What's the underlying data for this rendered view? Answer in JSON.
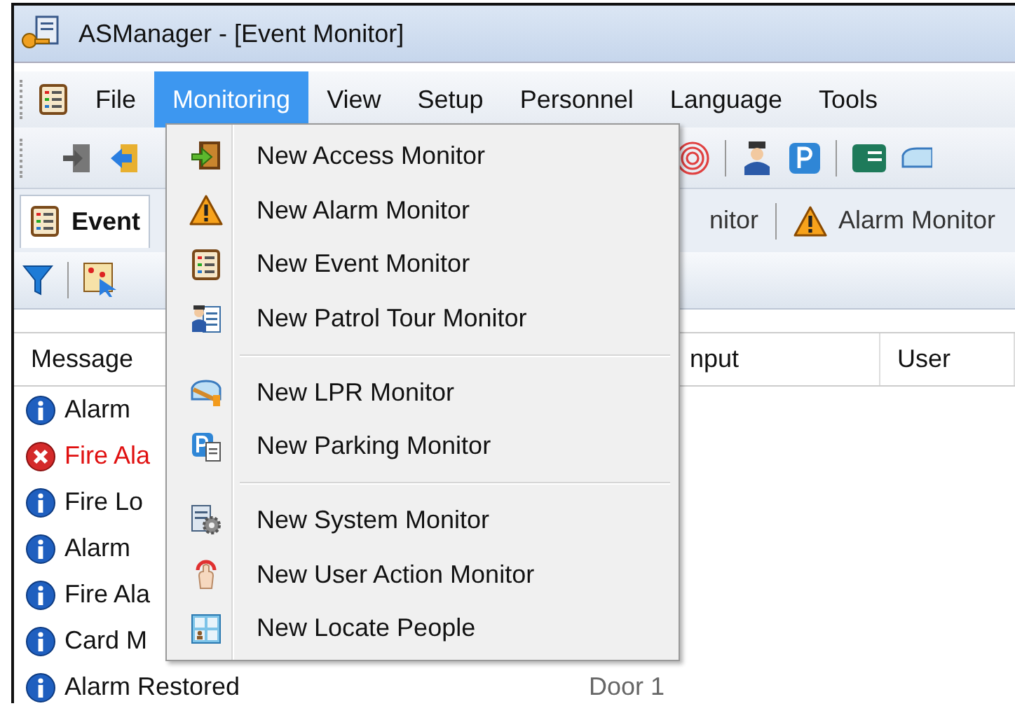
{
  "window": {
    "title": "ASManager - [Event Monitor]"
  },
  "menu_bar": [
    {
      "label": "File",
      "selected": false
    },
    {
      "label": "Monitoring",
      "selected": true
    },
    {
      "label": "View",
      "selected": false
    },
    {
      "label": "Setup",
      "selected": false
    },
    {
      "label": "Personnel",
      "selected": false
    },
    {
      "label": "Language",
      "selected": false
    },
    {
      "label": "Tools",
      "selected": false
    }
  ],
  "dropdown": {
    "groups": [
      [
        {
          "label": "New Access Monitor",
          "kind": "access"
        },
        {
          "label": "New Alarm Monitor",
          "kind": "alarm"
        },
        {
          "label": "New Event Monitor",
          "kind": "event"
        },
        {
          "label": "New Patrol Tour Monitor",
          "kind": "patrol"
        }
      ],
      [
        {
          "label": "New LPR Monitor",
          "kind": "lpr"
        },
        {
          "label": "New Parking Monitor",
          "kind": "parking"
        }
      ],
      [
        {
          "label": "New System Monitor",
          "kind": "system"
        },
        {
          "label": "New User Action Monitor",
          "kind": "useraction"
        },
        {
          "label": "New Locate People",
          "kind": "locate"
        }
      ]
    ]
  },
  "tabs": [
    {
      "label": "Event",
      "selected": true,
      "kind": "event"
    },
    {
      "label": "nitor",
      "selected": false
    },
    {
      "label": "Alarm Monitor",
      "selected": false,
      "kind": "alarm"
    }
  ],
  "table": {
    "columns": [
      {
        "label": "Message"
      },
      {},
      {
        "label": "nput"
      },
      {
        "label": "User"
      }
    ],
    "rows": [
      {
        "kind": "info",
        "cells": [
          "Alarm"
        ]
      },
      {
        "kind": "error",
        "cells": [
          "Fire Ala"
        ]
      },
      {
        "kind": "info",
        "cells": [
          "Fire Lo"
        ]
      },
      {
        "kind": "info",
        "cells": [
          "Alarm"
        ]
      },
      {
        "kind": "info",
        "cells": [
          "Fire Ala"
        ]
      },
      {
        "kind": "info",
        "cells": [
          "Card M"
        ]
      },
      {
        "kind": "info",
        "cells": [
          "Alarm Restored",
          "Door 1"
        ]
      }
    ]
  }
}
